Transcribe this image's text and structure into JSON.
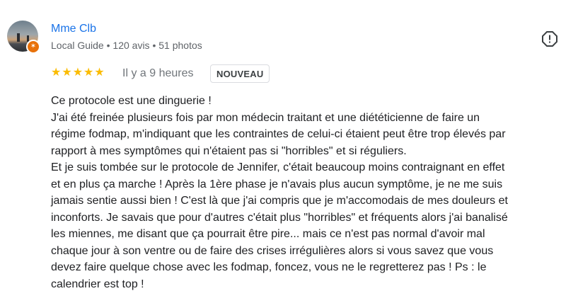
{
  "reviewer": {
    "name": "Mme Clb",
    "role": "Local Guide",
    "separator": "•",
    "reviews": "120 avis",
    "photos": "51 photos",
    "badge_icon": "local-guide-star-icon"
  },
  "rating": {
    "stars": 5,
    "max": 5,
    "star_glyph": "★",
    "color": "#fbbc04"
  },
  "time_ago": "Il y a 9 heures",
  "new_badge": "NOUVEAU",
  "report_icon": "report-flag-icon",
  "review_lines": [
    "Ce protocole est une dinguerie !",
    "J'ai été freinée plusieurs fois par mon médecin traitant et une diététicienne de faire un",
    "régime fodmap, m'indiquant que les contraintes de celui-ci étaient peut être trop élevés par",
    "rapport à mes symptômes qui n'étaient pas si \"horribles\" et si réguliers.",
    "Et je suis tombée sur le protocole de Jennifer, c'était beaucoup moins contraignant en effet",
    "et en plus ça marche ! Après la 1ère phase je n'avais plus aucun symptôme, je ne me suis",
    "jamais sentie aussi bien ! C'est là que j'ai compris que je m'accomodais de mes douleurs et",
    "inconforts. Je savais que pour d'autres c'était plus \"horribles\" et fréquents alors j'ai banalisé",
    "les miennes, me disant que ça pourrait être pire... mais ce n'est pas normal d'avoir mal",
    "chaque jour à son ventre ou de faire des crises irrégulières alors si vous savez que vous",
    "devez faire quelque chose avec les fodmap, foncez, vous ne le regretterez pas ! Ps : le",
    "calendrier est top !"
  ],
  "colors": {
    "name": "#1a73e8",
    "meta": "#5f6368",
    "badge_orange": "#e8710a"
  }
}
